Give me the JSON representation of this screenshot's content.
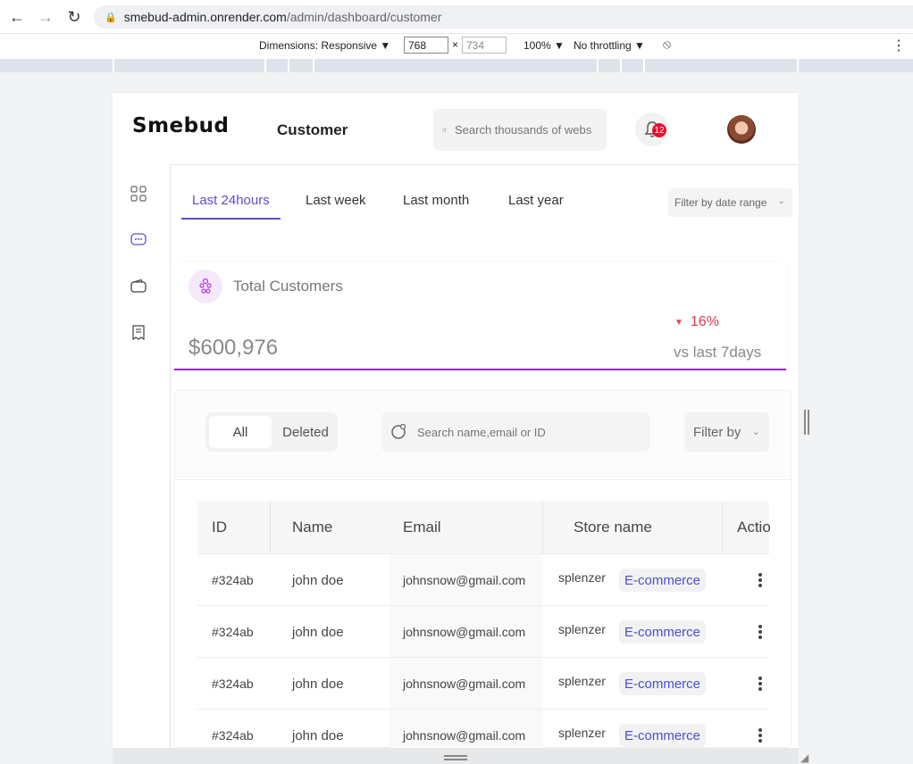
{
  "browser": {
    "url_host": "smebud-admin.onrender.com",
    "url_path": "/admin/dashboard/customer",
    "dimensions_label": "Dimensions: Responsive ▼",
    "width": "768",
    "height": "734",
    "zoom": "100% ▼",
    "throttling": "No throttling ▼"
  },
  "header": {
    "logo": "Smebud",
    "page_title": "Customer",
    "search_placeholder": "Search thousands of webs",
    "notifications_count": "12"
  },
  "tabs": [
    "Last 24hours",
    "Last week",
    "Last month",
    "Last year"
  ],
  "active_tab": 0,
  "date_filter": "Filter by date range",
  "summary": {
    "title": "Total Customers",
    "value": "$600,976",
    "change": "16%",
    "note": "vs last 7days"
  },
  "toolbar": {
    "segment_all": "All",
    "segment_deleted": "Deleted",
    "search_placeholder": "Search name,email or ID",
    "filter_label": "Filter by"
  },
  "table": {
    "columns": [
      "ID",
      "Name",
      "Email",
      "Store name",
      "Actio"
    ],
    "rows": [
      {
        "id": "#324ab",
        "name": "john doe",
        "email": "johnsnow@gmail.com",
        "store": "splenzer",
        "category": "E-commerce"
      },
      {
        "id": "#324ab",
        "name": "john doe",
        "email": "johnsnow@gmail.com",
        "store": "splenzer",
        "category": "E-commerce"
      },
      {
        "id": "#324ab",
        "name": "john doe",
        "email": "johnsnow@gmail.com",
        "store": "splenzer",
        "category": "E-commerce"
      },
      {
        "id": "#324ab",
        "name": "john doe",
        "email": "johnsnow@gmail.com",
        "store": "splenzer",
        "category": "E-commerce"
      }
    ]
  },
  "colors": {
    "accent": "#5a4fcf",
    "card_underline": "#9b21d4",
    "badge": "#e8112d",
    "negative": "#d93a4a"
  }
}
